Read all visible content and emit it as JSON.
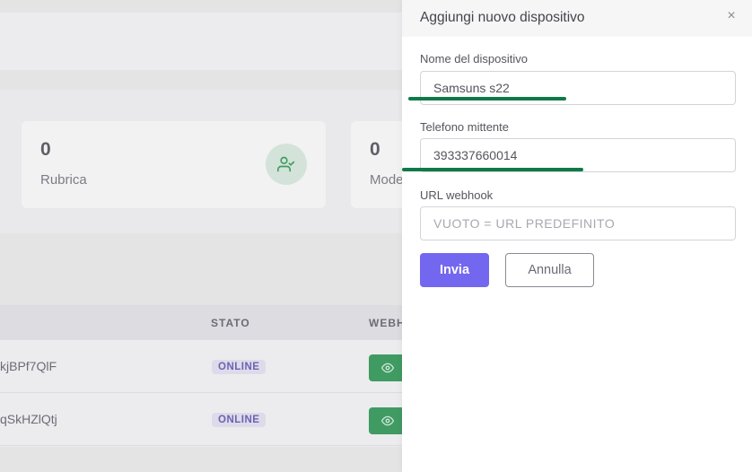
{
  "background": {
    "stats": [
      {
        "value": "0",
        "label": "Rubrica",
        "icon": "user-check-icon"
      },
      {
        "value": "0",
        "label": "Mode"
      }
    ],
    "table": {
      "columns": [
        "STATO",
        "WEBH"
      ],
      "rows": [
        {
          "id": "kjBPf7QlF",
          "status": "ONLINE"
        },
        {
          "id": "qSkHZlQtj",
          "status": "ONLINE"
        }
      ]
    }
  },
  "drawer": {
    "title": "Aggiungi nuovo dispositivo",
    "close_label": "×",
    "fields": {
      "device_name": {
        "label": "Nome del dispositivo",
        "value": "Samsuns s22"
      },
      "sender_phone": {
        "label": "Telefono mittente",
        "value": "393337660014"
      },
      "webhook": {
        "label": "URL webhook",
        "value": "",
        "placeholder": "VUOTO = URL PREDEFINITO"
      }
    },
    "submit_label": "Invia",
    "cancel_label": "Annulla"
  },
  "colors": {
    "primary": "#7367f0",
    "success": "#3d9e61",
    "annotation_underline": "#11784a"
  }
}
